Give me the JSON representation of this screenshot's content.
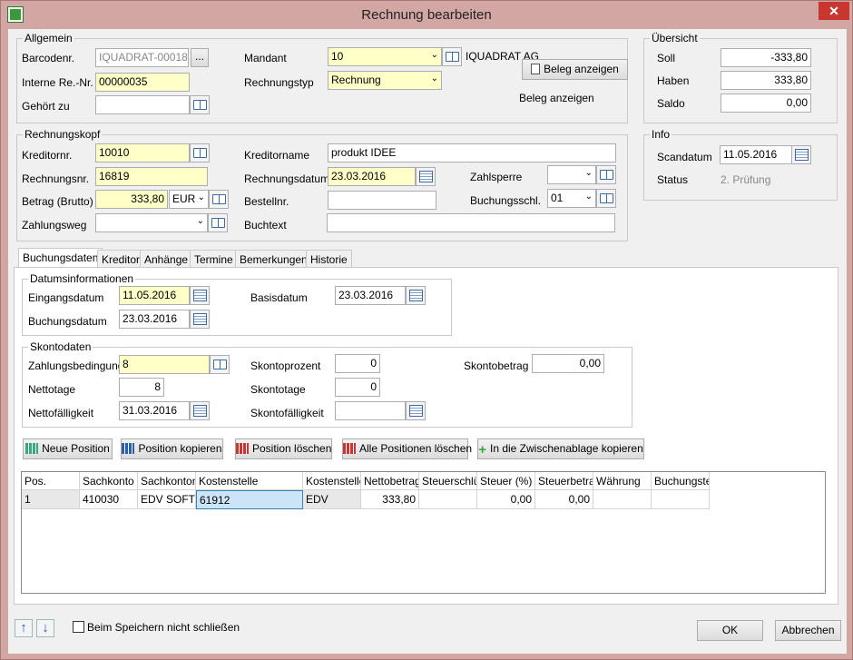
{
  "window": {
    "title": "Rechnung bearbeiten",
    "close": "✕"
  },
  "allgemein": {
    "title": "Allgemein",
    "barcode_label": "Barcodenr.",
    "barcode_value": "IQUADRAT-00018",
    "barcode_btn": "...",
    "interne_label": "Interne Re.-Nr.",
    "interne_value": "00000035",
    "gehoert_label": "Gehört zu",
    "gehoert_value": "",
    "mandant_label": "Mandant",
    "mandant_value": "10",
    "mandant_name": "IQUADRAT AG",
    "typ_label": "Rechnungstyp",
    "typ_value": "Rechnung",
    "beleg_btn": "Beleg anzeigen",
    "beleg_text": "Beleg anzeigen"
  },
  "uebersicht": {
    "title": "Übersicht",
    "soll_label": "Soll",
    "soll_value": "-333,80",
    "haben_label": "Haben",
    "haben_value": "333,80",
    "saldo_label": "Saldo",
    "saldo_value": "0,00"
  },
  "info": {
    "title": "Info",
    "scandatum_label": "Scandatum",
    "scandatum_value": "11.05.2016",
    "status_label": "Status",
    "status_value": "2. Prüfung"
  },
  "kopf": {
    "title": "Rechnungskopf",
    "kreditornr_label": "Kreditornr.",
    "kreditornr_value": "10010",
    "rechnungsnr_label": "Rechnungsnr.",
    "rechnungsnr_value": "16819",
    "betrag_label": "Betrag (Brutto)",
    "betrag_value": "333,80",
    "waehrung_value": "EUR",
    "zahlungsweg_label": "Zahlungsweg",
    "zahlungsweg_value": "",
    "kreditorname_label": "Kreditorname",
    "kreditorname_value": "produkt IDEE",
    "rechnungsdatum_label": "Rechnungsdatum",
    "rechnungsdatum_value": "23.03.2016",
    "bestellnr_label": "Bestellnr.",
    "bestellnr_value": "",
    "buchtext_label": "Buchtext",
    "buchtext_value": "",
    "zahlsperre_label": "Zahlsperre",
    "zahlsperre_value": "",
    "buchungsschl_label": "Buchungsschl.",
    "buchungsschl_value": "01"
  },
  "tabs": [
    "Buchungsdaten",
    "Kreditor",
    "Anhänge",
    "Termine",
    "Bemerkungen",
    "Historie"
  ],
  "datum": {
    "title": "Datumsinformationen",
    "eingang_label": "Eingangsdatum",
    "eingang_value": "11.05.2016",
    "buchung_label": "Buchungsdatum",
    "buchung_value": "23.03.2016",
    "basis_label": "Basisdatum",
    "basis_value": "23.03.2016"
  },
  "skonto": {
    "title": "Skontodaten",
    "zb_label": "Zahlungsbedingung",
    "zb_value": "8",
    "netto_label": "Nettotage",
    "netto_value": "8",
    "nettof_label": "Nettofälligkeit",
    "nettof_value": "31.03.2016",
    "sproz_label": "Skontoprozent",
    "sproz_value": "0",
    "stage_label": "Skontotage",
    "stage_value": "0",
    "sfaell_label": "Skontofälligkeit",
    "sfaell_value": "",
    "sbetrag_label": "Skontobetrag",
    "sbetrag_value": "0,00"
  },
  "actions": {
    "neu": "Neue Position",
    "kopieren": "Position kopieren",
    "loeschen": "Position löschen",
    "alle": "Alle Positionen löschen",
    "clip": "In die Zwischenablage kopieren"
  },
  "grid": {
    "headers": [
      "Pos.",
      "Sachkonto",
      "Sachkontonam",
      "Kostenstelle",
      "Kostenstelle",
      "Nettobetrag",
      "Steuerschlüs",
      "Steuer (%)",
      "Steuerbetra",
      "Währung",
      "Buchungstex"
    ],
    "row": [
      "1",
      "410030",
      "EDV SOFTW",
      "61912",
      "EDV",
      "333,80",
      "",
      "0,00",
      "0,00",
      "",
      ""
    ]
  },
  "footer": {
    "nicht_schliessen": "Beim Speichern nicht schließen",
    "ok": "OK",
    "abbrechen": "Abbrechen"
  }
}
